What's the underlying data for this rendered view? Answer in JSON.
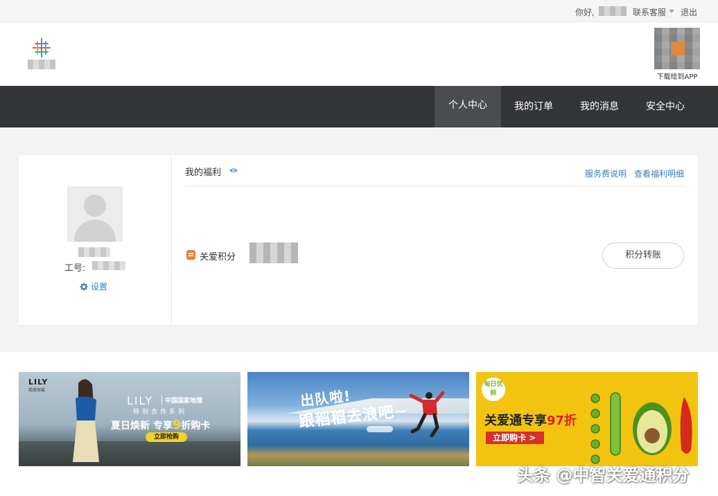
{
  "topbar": {
    "greeting": "你好,",
    "service": "联系客服",
    "logout": "退出"
  },
  "header": {
    "qr_label": "下载给到APP"
  },
  "nav": {
    "items": [
      "个人中心",
      "我的订单",
      "我的消息",
      "安全中心"
    ],
    "active": "个人中心"
  },
  "profile": {
    "employee_label": "工号:",
    "settings": "设置"
  },
  "welfare": {
    "title": "我的福利",
    "link_service_fee": "服务费说明",
    "link_details": "查看福利明细",
    "points_label": "关爱积分",
    "transfer_button": "积分转账"
  },
  "banners": [
    {
      "brand": "LILY",
      "brand_sub": "商务时装",
      "brand_big": "LILY",
      "partner": "中国国家地理",
      "series": "特别合作系列",
      "promo_prefix": "夏日焕新 专享",
      "promo_number": "9",
      "promo_suffix": "折购卡",
      "cta": "立即抢购"
    },
    {
      "line1": "出队啦!",
      "line2": "跟稻稻去浪吧~"
    },
    {
      "badge": "每日优鲜",
      "headline_prefix": "关爱通专享",
      "headline_value": "97折",
      "cta": "立即购卡 >"
    }
  ],
  "watermark": "头条 @中智关爱通积分",
  "colors": {
    "nav_bg": "#333538",
    "nav_active_bg": "#4a4c4f",
    "link": "#3a7fc1",
    "points_icon": "#ef7b3e",
    "banner3_bg": "#f2c40f"
  }
}
